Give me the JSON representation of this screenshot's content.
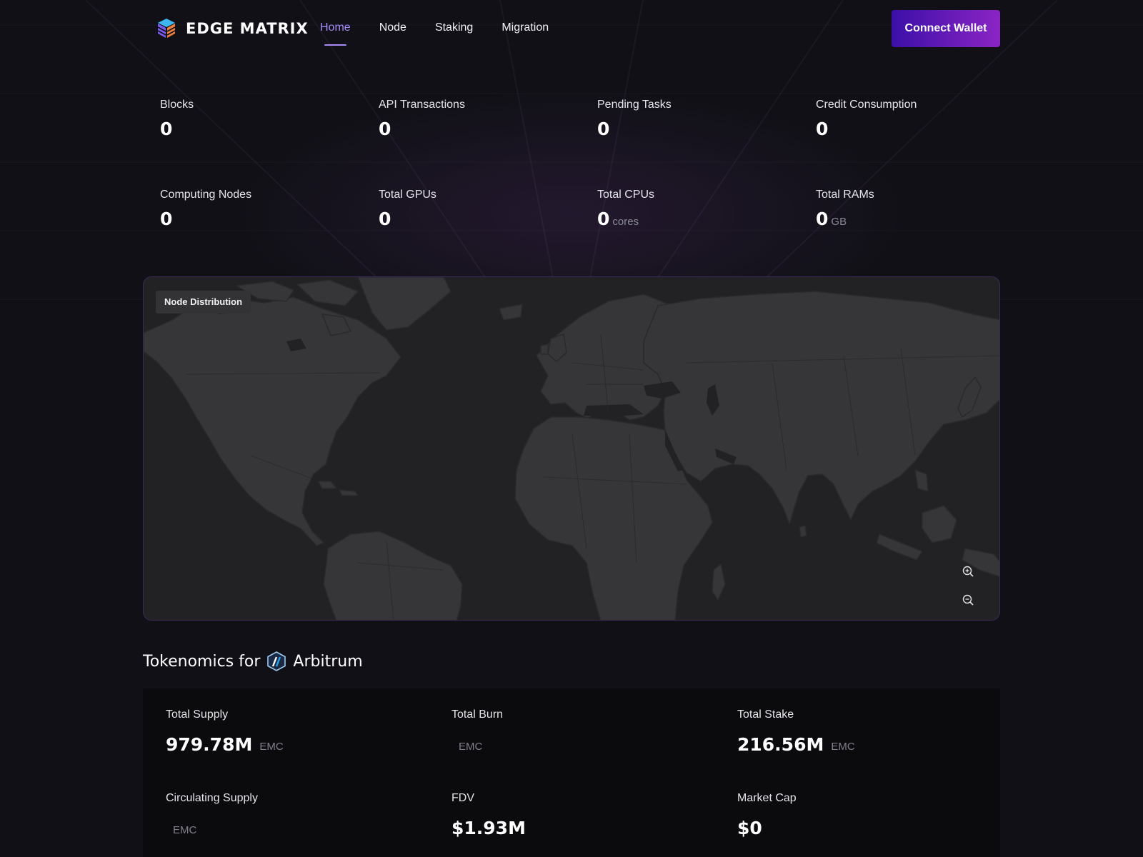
{
  "brand": {
    "name": "EDGE MATRIX"
  },
  "nav": {
    "items": [
      {
        "label": "Home",
        "active": true
      },
      {
        "label": "Node",
        "active": false
      },
      {
        "label": "Staking",
        "active": false
      },
      {
        "label": "Migration",
        "active": false
      }
    ]
  },
  "header": {
    "connect_label": "Connect Wallet"
  },
  "stats": [
    {
      "label": "Blocks",
      "value": "0",
      "unit": ""
    },
    {
      "label": "API Transactions",
      "value": "0",
      "unit": ""
    },
    {
      "label": "Pending Tasks",
      "value": "0",
      "unit": ""
    },
    {
      "label": "Credit Consumption",
      "value": "0",
      "unit": ""
    },
    {
      "label": "Computing Nodes",
      "value": "0",
      "unit": ""
    },
    {
      "label": "Total GPUs",
      "value": "0",
      "unit": ""
    },
    {
      "label": "Total CPUs",
      "value": "0",
      "unit": "cores"
    },
    {
      "label": "Total RAMs",
      "value": "0",
      "unit": "GB"
    }
  ],
  "map": {
    "tag": "Node Distribution",
    "zoom_in": "zoom-in-icon",
    "zoom_out": "zoom-out-icon"
  },
  "tokenomics": {
    "title_prefix": "Tokenomics for",
    "network": "Arbitrum",
    "items": [
      {
        "label": "Total Supply",
        "value": "979.78M",
        "unit": "EMC"
      },
      {
        "label": "Total Burn",
        "value": "",
        "unit": "EMC"
      },
      {
        "label": "Total Stake",
        "value": "216.56M",
        "unit": "EMC"
      },
      {
        "label": "Circulating Supply",
        "value": "",
        "unit": "EMC"
      },
      {
        "label": "FDV",
        "value": "$1.93M",
        "unit": ""
      },
      {
        "label": "Market Cap",
        "value": "$0",
        "unit": ""
      }
    ]
  },
  "colors": {
    "accent": "#a78bfa",
    "button_start": "#3b0fa8",
    "button_end": "#8a25c4",
    "map_land": "#363638",
    "map_sea": "#222224"
  }
}
